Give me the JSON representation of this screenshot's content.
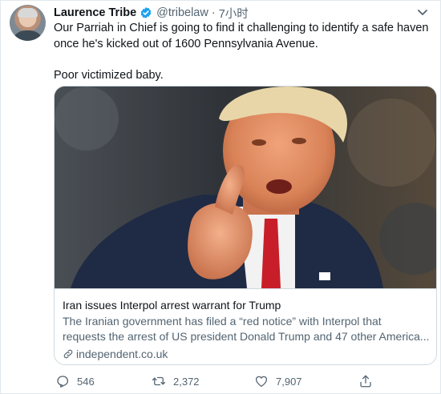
{
  "tweet": {
    "author_name": "Laurence Tribe",
    "handle": "@tribelaw",
    "separator": "·",
    "time": "7小时",
    "text_line1": "Our Parriah in Chief is going to find it challenging to identify a safe haven once he's kicked out of 1600 Pennsylvania Avenue.",
    "text_line2": "Poor victimized baby."
  },
  "card": {
    "title": "Iran issues Interpol arrest warrant for Trump",
    "description_line1": "The Iranian government has filed a “red notice” with Interpol that",
    "description_line2": "requests the arrest of US president Donald Trump and 47 other America...",
    "domain": "independent.co.uk"
  },
  "actions": {
    "replies": "546",
    "retweets": "2,372",
    "likes": "7,907"
  },
  "colors": {
    "accent": "#1da1f2",
    "secondary_text": "#536471",
    "border": "#cfd9de"
  },
  "icons": [
    "verified-badge-icon",
    "chevron-down-icon",
    "link-icon",
    "reply-icon",
    "retweet-icon",
    "like-icon",
    "share-icon"
  ]
}
